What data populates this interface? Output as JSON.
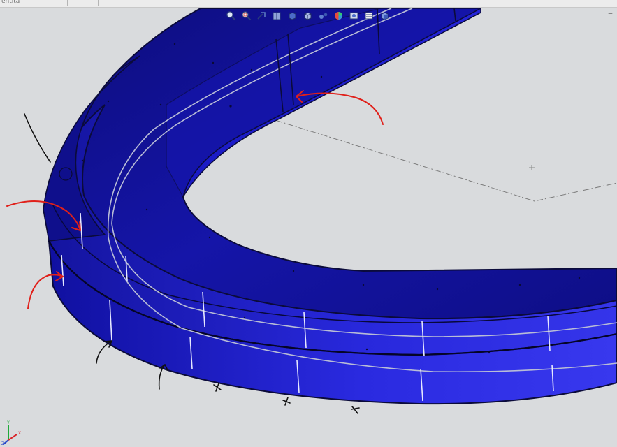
{
  "window": {
    "tab_label": "entita",
    "minimize_label": "–"
  },
  "heads_up_toolbar": [
    {
      "name": "zoom-to-fit-icon"
    },
    {
      "name": "zoom-to-area-icon"
    },
    {
      "name": "previous-view-icon"
    },
    {
      "name": "section-view-icon"
    },
    {
      "name": "view-orientation-icon"
    },
    {
      "name": "display-style-icon"
    },
    {
      "name": "hide-show-items-icon"
    },
    {
      "name": "edit-appearance-icon"
    },
    {
      "name": "apply-scene-icon"
    },
    {
      "name": "view-settings-icon"
    },
    {
      "name": "display-pane-icon"
    }
  ],
  "colors": {
    "viewport_background": "#d9dbdd",
    "part_face_dark": "#10108e",
    "part_face_mid": "#1c1ccb",
    "part_face_light": "#3232e6",
    "edge_line": "#0b0b3a",
    "centerline": "#b9bdd6",
    "annotation_red": "#e0201a",
    "annotation_black": "#111111",
    "sketch_line": "#7b7b7b"
  },
  "coordinate_triad": {
    "axes": [
      "X",
      "Y",
      "Z"
    ]
  }
}
